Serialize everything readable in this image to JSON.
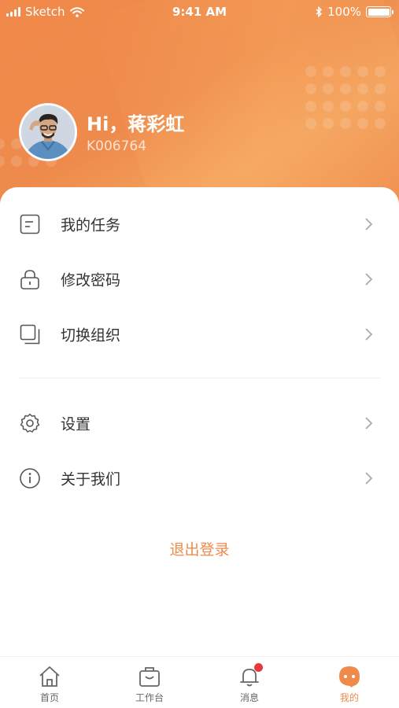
{
  "status_bar": {
    "carrier": "Sketch",
    "time": "9:41 AM",
    "battery": "100%"
  },
  "profile": {
    "greeting": "Hi，蒋彩虹",
    "user_id": "K006764"
  },
  "menu": {
    "items": [
      {
        "label": "我的任务",
        "icon": "task-document-icon"
      },
      {
        "label": "修改密码",
        "icon": "lock-icon"
      },
      {
        "label": "切换组织",
        "icon": "switch-organization-icon"
      },
      {
        "label": "设置",
        "icon": "gear-icon"
      },
      {
        "label": "关于我们",
        "icon": "info-icon"
      }
    ]
  },
  "logout_label": "退出登录",
  "tabbar": {
    "tabs": [
      {
        "label": "首页",
        "icon": "home-icon",
        "active": false
      },
      {
        "label": "工作台",
        "icon": "briefcase-icon",
        "active": false
      },
      {
        "label": "消息",
        "icon": "bell-icon",
        "active": false,
        "badge": true
      },
      {
        "label": "我的",
        "icon": "profile-face-icon",
        "active": true
      }
    ]
  },
  "colors": {
    "accent": "#ef8a4b",
    "badge": "#e8373d",
    "text": "#333333"
  }
}
